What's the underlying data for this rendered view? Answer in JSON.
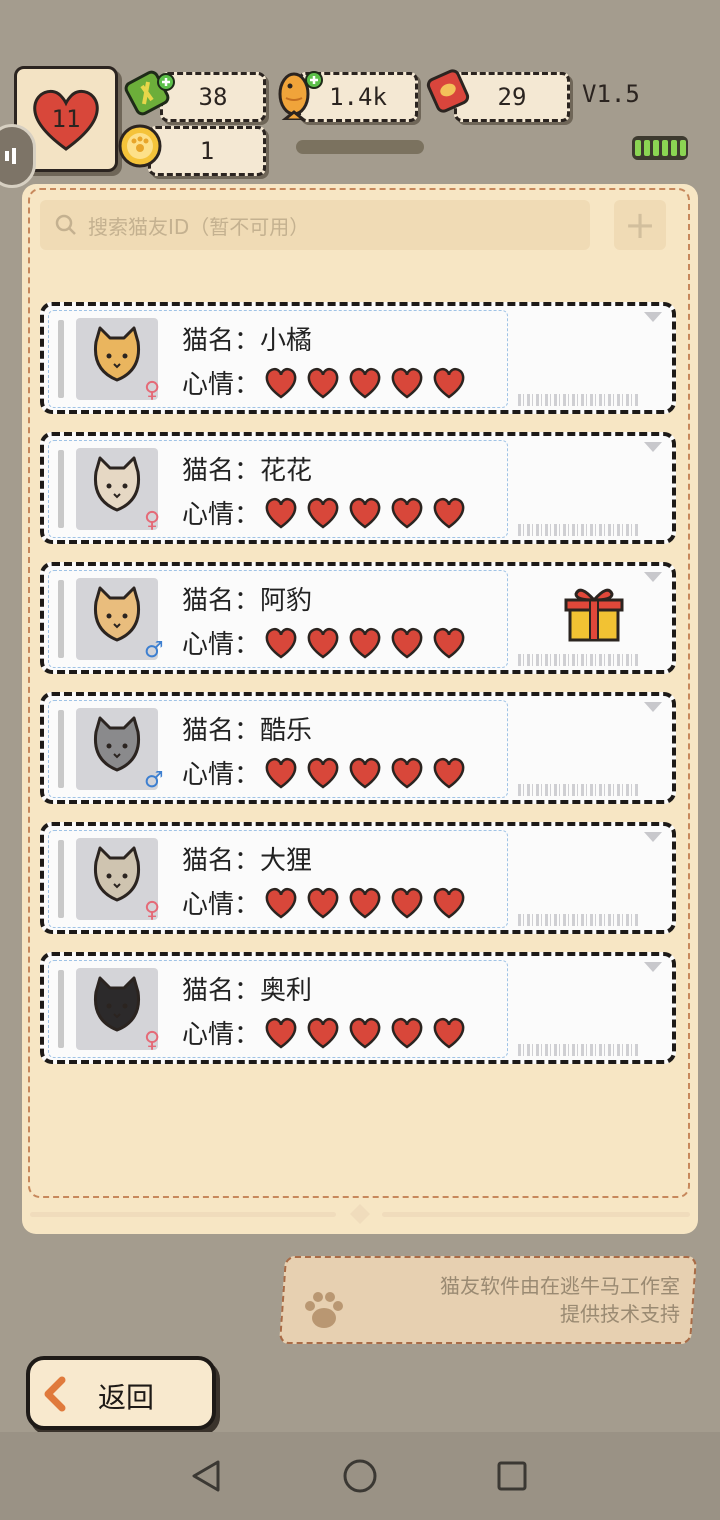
{
  "status": {
    "hearts": "11",
    "banknotes": "38",
    "fish": "1.4k",
    "cans": "29",
    "coins": "1",
    "version": "V1.5"
  },
  "search": {
    "placeholder": "搜索猫友ID（暂不可用）",
    "add_label": "+"
  },
  "cats": [
    {
      "name_label": "猫名：",
      "name": "小橘",
      "mood_label": "心情：",
      "mood": 5,
      "gender": "♀",
      "color": "#eab55e"
    },
    {
      "name_label": "猫名：",
      "name": "花花",
      "mood_label": "心情：",
      "mood": 5,
      "gender": "♀",
      "color": "#e6d8c4"
    },
    {
      "name_label": "猫名：",
      "name": "阿豹",
      "mood_label": "心情：",
      "mood": 5,
      "gender": "♂",
      "color": "#e9bd7d",
      "gift": true
    },
    {
      "name_label": "猫名：",
      "name": "酷乐",
      "mood_label": "心情：",
      "mood": 5,
      "gender": "♂",
      "color": "#8a8a8c"
    },
    {
      "name_label": "猫名：",
      "name": "大狸",
      "mood_label": "心情：",
      "mood": 5,
      "gender": "♀",
      "color": "#cfc4b0"
    },
    {
      "name_label": "猫名：",
      "name": "奥利",
      "mood_label": "心情：",
      "mood": 5,
      "gender": "♀",
      "color": "#2c2a2b"
    }
  ],
  "credit": {
    "line1": "猫友软件由在逃牛马工作室",
    "line2": "提供技术支持"
  },
  "back_label": "返回",
  "colors": {
    "heart": "#d8473a",
    "female": "#e56a77",
    "male": "#3d7fd0"
  }
}
